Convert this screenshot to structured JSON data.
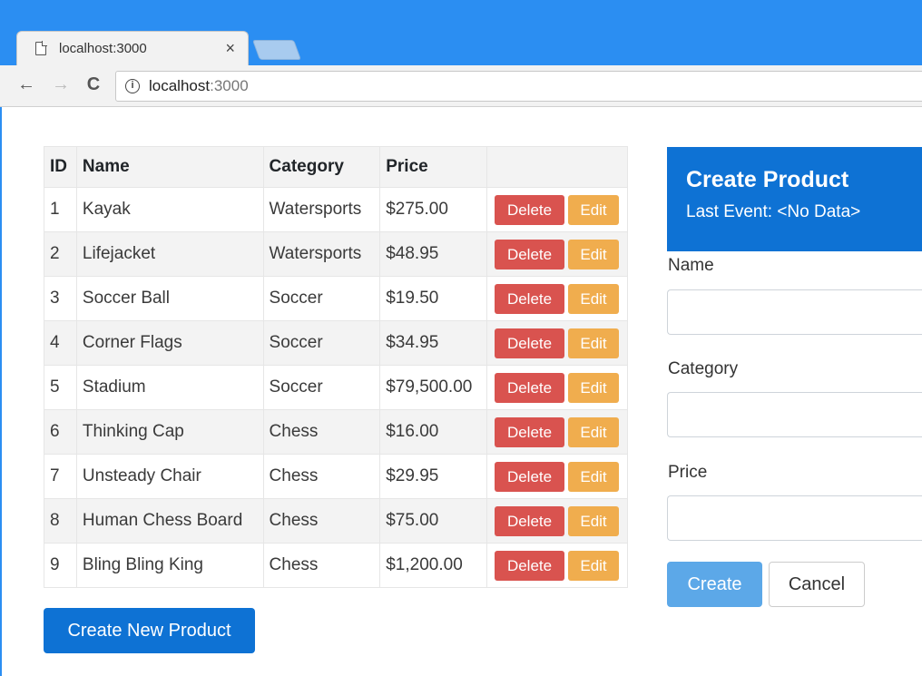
{
  "browser": {
    "tab_title": "localhost:3000",
    "tab_close": "×",
    "url_host": "localhost",
    "url_port": ":3000",
    "back_icon": "←",
    "forward_icon": "→",
    "reload_icon": "C",
    "info_icon": "i"
  },
  "table": {
    "headers": [
      "ID",
      "Name",
      "Category",
      "Price",
      ""
    ],
    "rows": [
      {
        "id": "1",
        "name": "Kayak",
        "category": "Watersports",
        "price": "$275.00"
      },
      {
        "id": "2",
        "name": "Lifejacket",
        "category": "Watersports",
        "price": "$48.95"
      },
      {
        "id": "3",
        "name": "Soccer Ball",
        "category": "Soccer",
        "price": "$19.50"
      },
      {
        "id": "4",
        "name": "Corner Flags",
        "category": "Soccer",
        "price": "$34.95"
      },
      {
        "id": "5",
        "name": "Stadium",
        "category": "Soccer",
        "price": "$79,500.00"
      },
      {
        "id": "6",
        "name": "Thinking Cap",
        "category": "Chess",
        "price": "$16.00"
      },
      {
        "id": "7",
        "name": "Unsteady Chair",
        "category": "Chess",
        "price": "$29.95"
      },
      {
        "id": "8",
        "name": "Human Chess Board",
        "category": "Chess",
        "price": "$75.00"
      },
      {
        "id": "9",
        "name": "Bling Bling King",
        "category": "Chess",
        "price": "$1,200.00"
      }
    ],
    "delete_label": "Delete",
    "edit_label": "Edit"
  },
  "create_new_label": "Create New Product",
  "panel": {
    "title": "Create Product",
    "last_event": "Last Event: <No Data>",
    "fields": {
      "name_label": "Name",
      "name_value": "",
      "category_label": "Category",
      "category_value": "",
      "price_label": "Price",
      "price_value": ""
    },
    "create_label": "Create",
    "cancel_label": "Cancel"
  },
  "colors": {
    "chrome_blue": "#2b8ef2",
    "primary": "#0e72d4",
    "danger": "#d9534f",
    "warning": "#f0ad4e",
    "primary_light": "#5ca8e8"
  }
}
